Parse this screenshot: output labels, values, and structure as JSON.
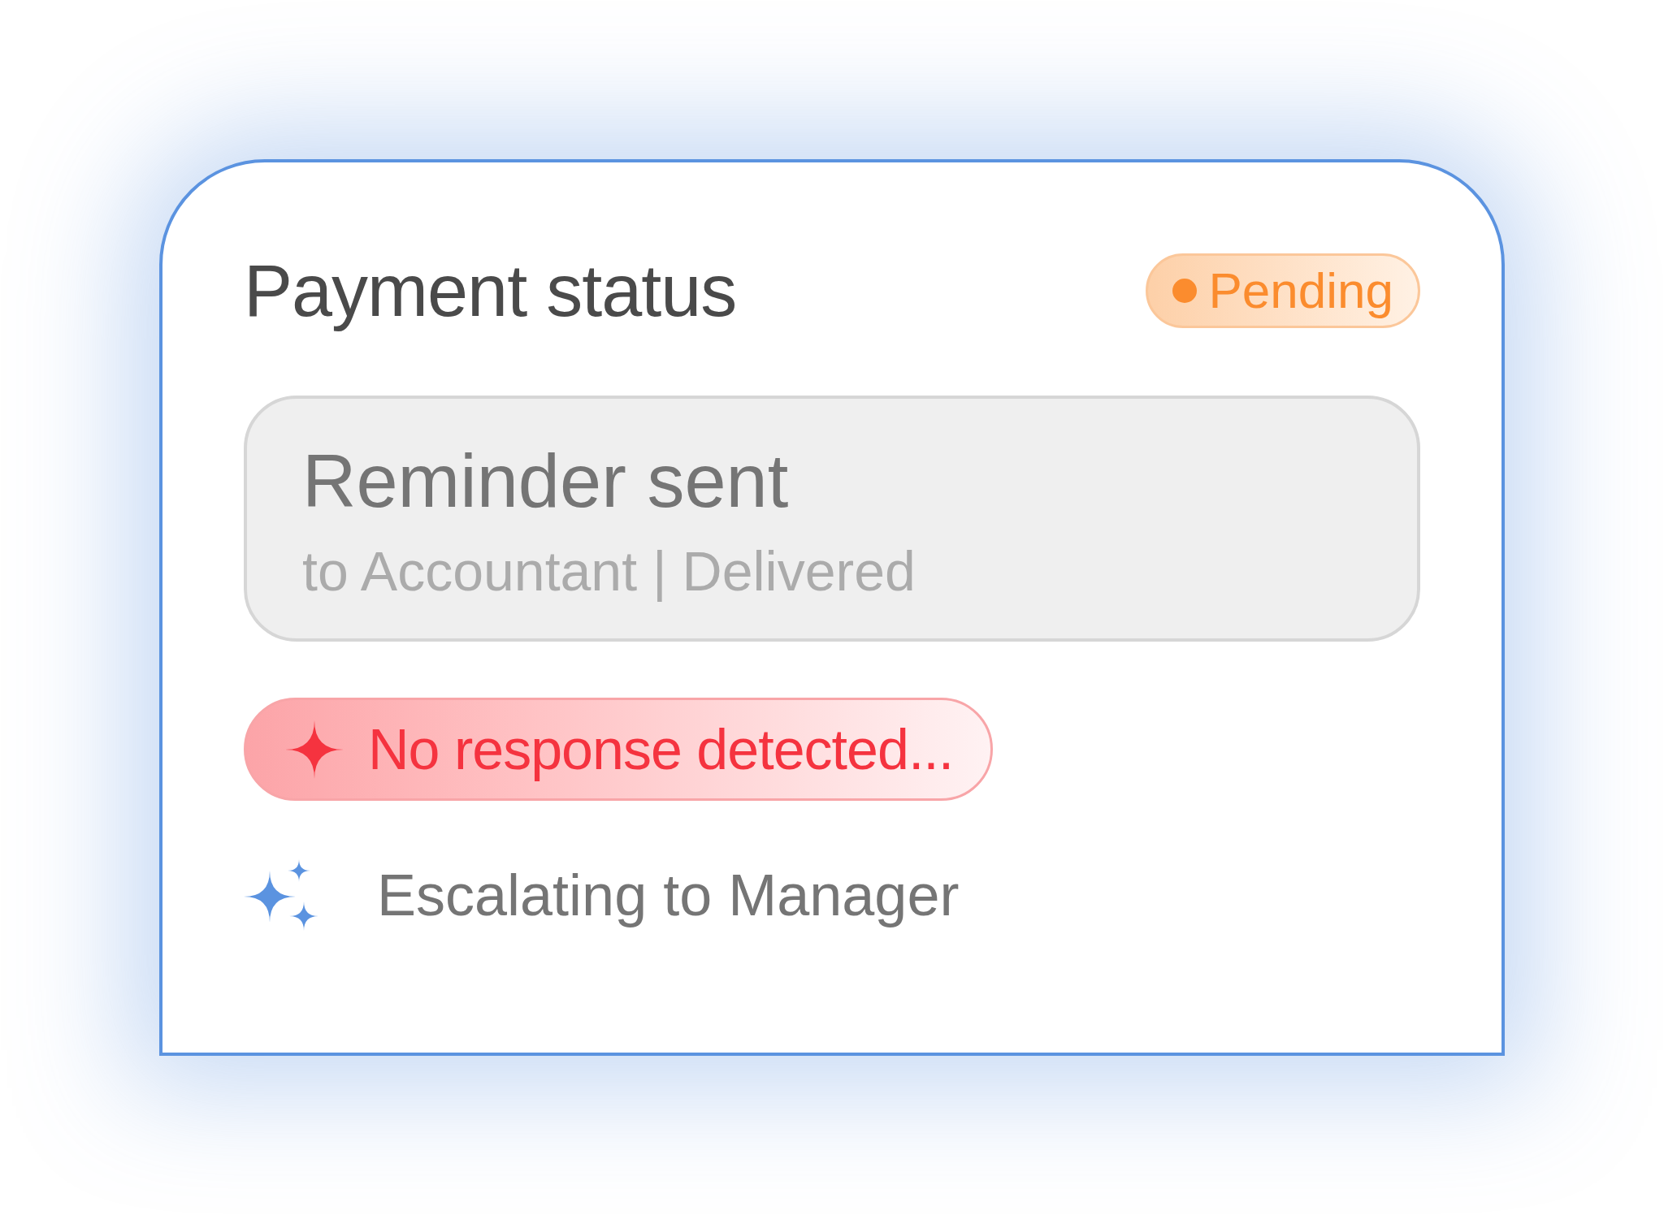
{
  "title": "Payment status",
  "status": {
    "label": "Pending"
  },
  "reminder": {
    "title": "Reminder sent",
    "detail": "to Accountant | Delivered"
  },
  "alert": {
    "text": "No response detected..."
  },
  "next_step": {
    "text": "Escalating to Manager"
  }
}
